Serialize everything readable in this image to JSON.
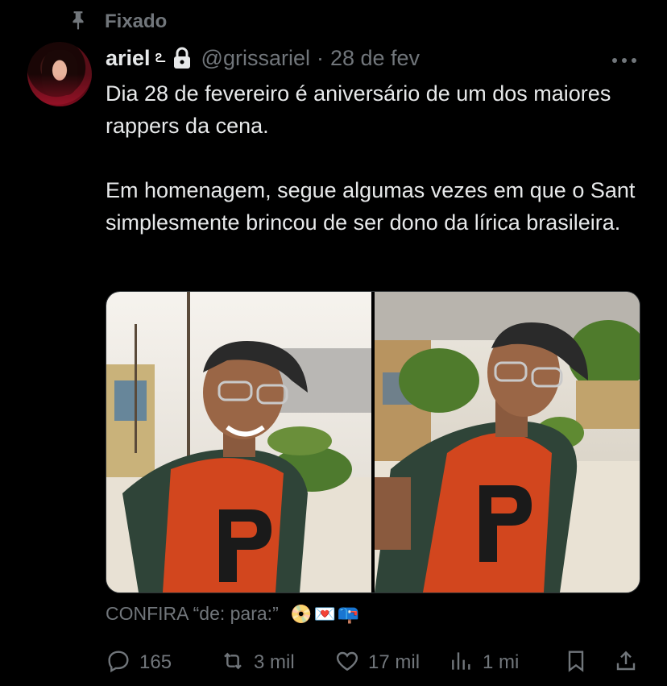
{
  "pinned": {
    "label": "Fixado",
    "icon": "pin-icon"
  },
  "author": {
    "name": "ariel",
    "name_emoji": "ఽ",
    "handle": "@grissariel",
    "separator": "·",
    "date": "28 de fev",
    "protected_icon": "lock-icon"
  },
  "tweet": {
    "paragraph1": "Dia 28 de fevereiro é aniversário de um dos maiores rappers da cena.",
    "paragraph2": "Em homenagem, segue algumas vezes em que o Sant simplesmente brincou de ser dono da lírica brasileira."
  },
  "caption": {
    "text": "CONFIRA “de: para:”",
    "emojis": "📀💌📪"
  },
  "actions": {
    "replies": "165",
    "retweets": "3 mil",
    "likes": "17 mil",
    "views": "1 mi"
  },
  "colors": {
    "background": "#000000",
    "text": "#e7e9ea",
    "muted": "#71767b",
    "shirt": "#d2461e"
  }
}
